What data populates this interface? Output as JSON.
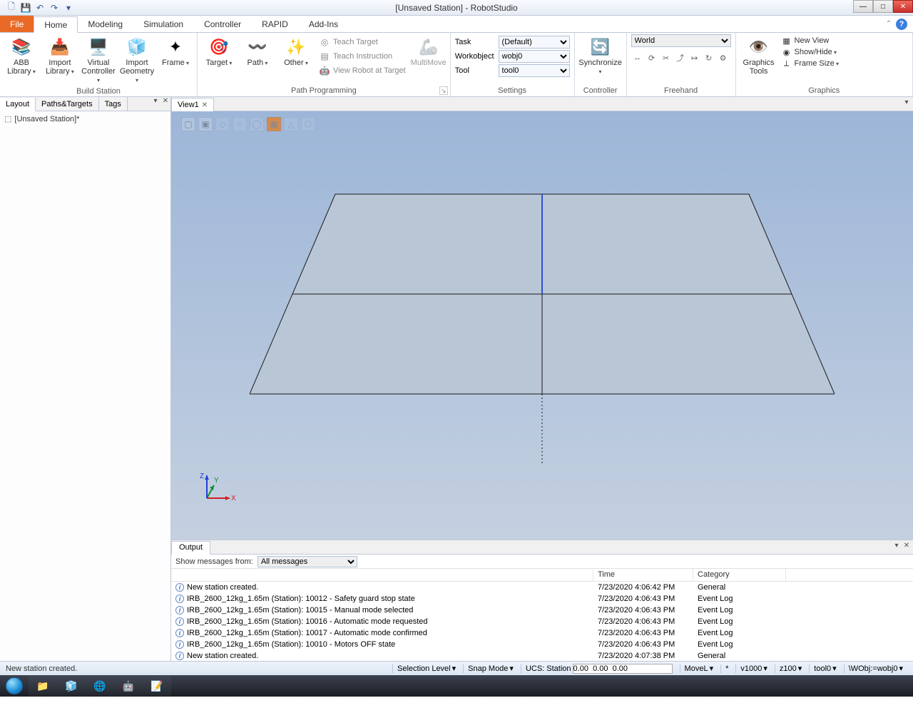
{
  "window": {
    "title": "[Unsaved Station] - RobotStudio"
  },
  "qat": [
    "🗋",
    "💾",
    "↶",
    "↷",
    "▾"
  ],
  "ribbon_tabs": {
    "file": "File",
    "tabs": [
      "Home",
      "Modeling",
      "Simulation",
      "Controller",
      "RAPID",
      "Add-Ins"
    ],
    "active": "Home"
  },
  "ribbon": {
    "build_station": {
      "title": "Build Station",
      "abb_library": "ABB Library",
      "import_library": "Import Library",
      "virtual_controller": "Virtual Controller",
      "import_geometry": "Import Geometry",
      "frame": "Frame"
    },
    "path_programming": {
      "title": "Path Programming",
      "target": "Target",
      "path": "Path",
      "other": "Other",
      "teach_target": "Teach Target",
      "teach_instruction": "Teach Instruction",
      "view_robot": "View Robot at Target",
      "multimove": "MultiMove"
    },
    "settings": {
      "title": "Settings",
      "task": "Task",
      "task_val": "(Default)",
      "workobject": "Workobject",
      "workobject_val": "wobj0",
      "tool": "Tool",
      "tool_val": "tool0"
    },
    "controller": {
      "title": "Controller",
      "synchronize": "Synchronize"
    },
    "freehand": {
      "title": "Freehand",
      "world": "World"
    },
    "graphics": {
      "title": "Graphics",
      "tools": "Graphics Tools",
      "new_view": "New View",
      "show_hide": "Show/Hide",
      "frame_size": "Frame Size"
    }
  },
  "left_panel": {
    "tabs": [
      "Layout",
      "Paths&Targets",
      "Tags"
    ],
    "active": "Layout",
    "station_name": "[Unsaved Station]*"
  },
  "view": {
    "tab": "View1"
  },
  "output": {
    "tab": "Output",
    "filter_label": "Show messages from:",
    "filter_value": "All messages",
    "headers": {
      "msg": "",
      "time": "Time",
      "cat": "Category"
    },
    "rows": [
      {
        "msg": "New station created.",
        "time": "7/23/2020 4:06:42 PM",
        "cat": "General"
      },
      {
        "msg": "IRB_2600_12kg_1.65m (Station): 10012 - Safety guard stop state",
        "time": "7/23/2020 4:06:43 PM",
        "cat": "Event Log"
      },
      {
        "msg": "IRB_2600_12kg_1.65m (Station): 10015 - Manual mode selected",
        "time": "7/23/2020 4:06:43 PM",
        "cat": "Event Log"
      },
      {
        "msg": "IRB_2600_12kg_1.65m (Station): 10016 - Automatic mode requested",
        "time": "7/23/2020 4:06:43 PM",
        "cat": "Event Log"
      },
      {
        "msg": "IRB_2600_12kg_1.65m (Station): 10017 - Automatic mode confirmed",
        "time": "7/23/2020 4:06:43 PM",
        "cat": "Event Log"
      },
      {
        "msg": "IRB_2600_12kg_1.65m (Station): 10010 - Motors OFF state",
        "time": "7/23/2020 4:06:43 PM",
        "cat": "Event Log"
      },
      {
        "msg": "New station created.",
        "time": "7/23/2020 4:07:38 PM",
        "cat": "General"
      }
    ]
  },
  "statusbar": {
    "left": "New station created.",
    "selection_level": "Selection Level",
    "snap_mode": "Snap Mode",
    "ucs": "UCS: Station",
    "ucs_val": "0.00  0.00  0.00",
    "motion": "MoveL",
    "sep": "*",
    "speed": "v1000",
    "zone": "z100",
    "tool": "tool0",
    "wobj": "\\WObj:=wobj0"
  }
}
